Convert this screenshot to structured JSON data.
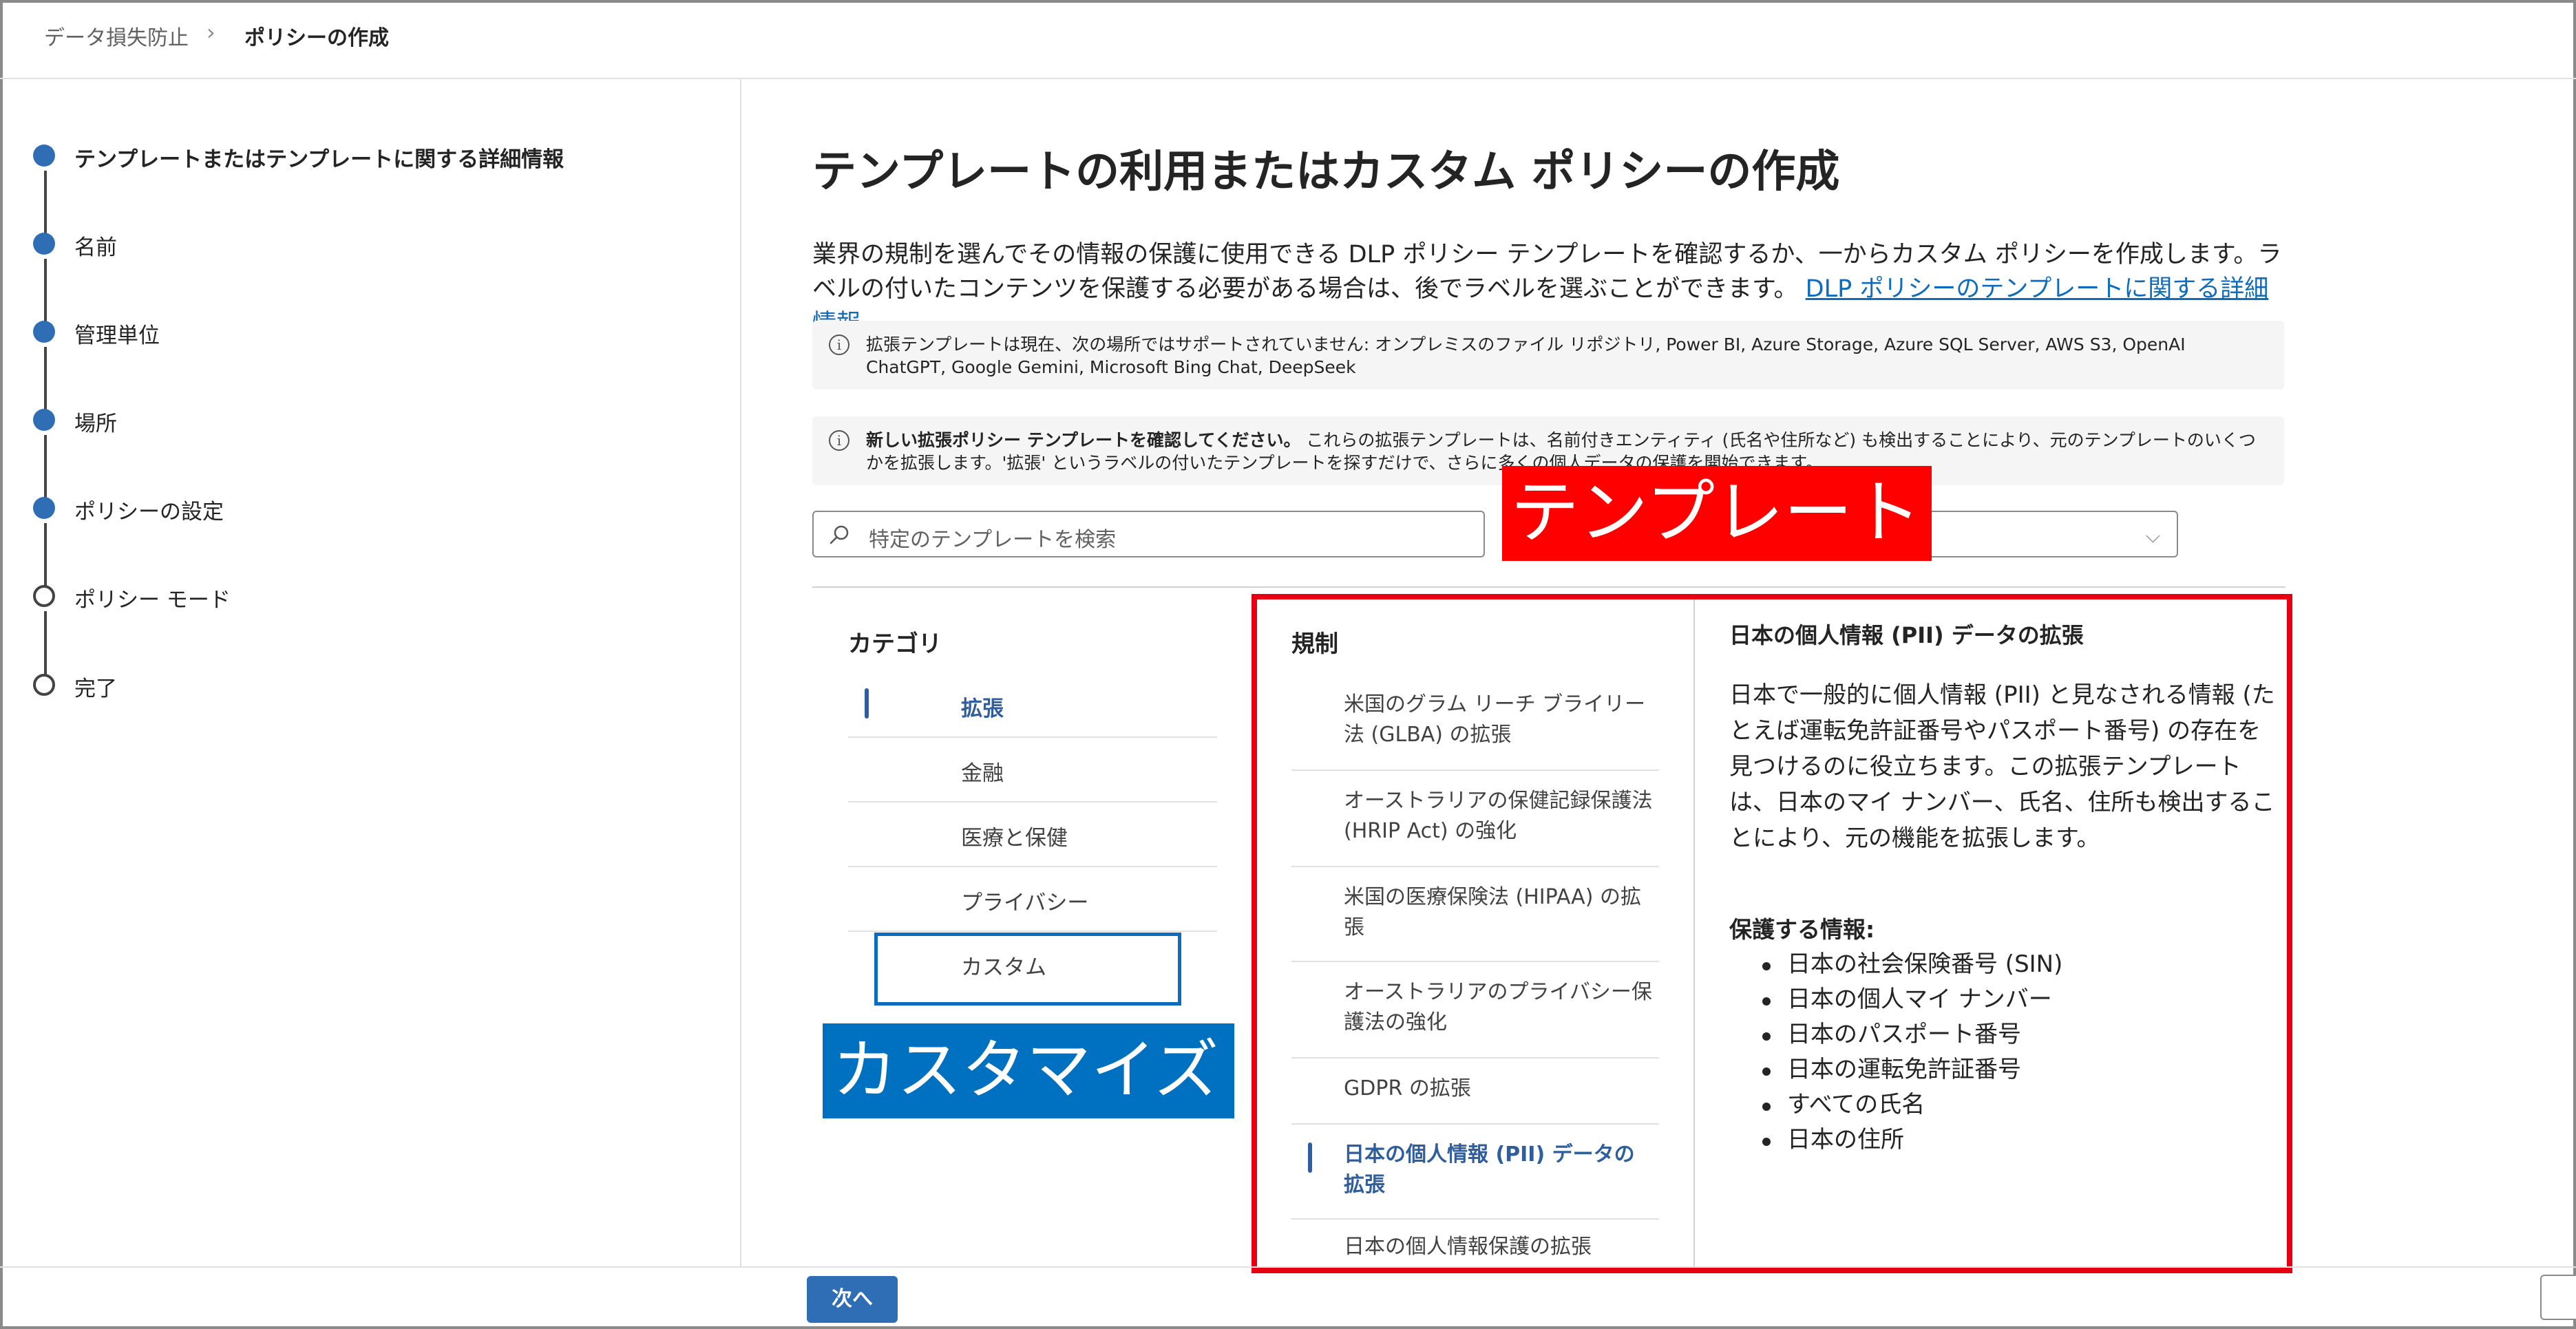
{
  "breadcrumb": {
    "parent": "データ損失防止",
    "separator": "›",
    "current": "ポリシーの作成"
  },
  "steps": [
    {
      "label": "テンプレートまたはテンプレートに関する詳細情報",
      "state": "current"
    },
    {
      "label": "名前",
      "state": "completed"
    },
    {
      "label": "管理単位",
      "state": "completed"
    },
    {
      "label": "場所",
      "state": "completed"
    },
    {
      "label": "ポリシーの設定",
      "state": "completed"
    },
    {
      "label": "ポリシー モード",
      "state": "pending"
    },
    {
      "label": "完了",
      "state": "pending"
    }
  ],
  "main": {
    "title": "テンプレートの利用またはカスタム ポリシーの作成",
    "description": "業界の規制を選んでその情報の保護に使用できる DLP ポリシー テンプレートを確認するか、一からカスタム ポリシーを作成します。ラベルの付いたコンテンツを保護する必要がある場合は、後でラベルを選ぶことができます。",
    "learn_more_link": "DLP ポリシーのテンプレートに関する詳細情報",
    "info1": "拡張テンプレートは現在、次の場所ではサポートされていません: オンプレミスのファイル リポジトリ, Power BI, Azure Storage, Azure SQL Server, AWS S3, OpenAI ChatGPT, Google Gemini, Microsoft Bing Chat, DeepSeek",
    "info2_bold": "新しい拡張ポリシー テンプレートを確認してください。",
    "info2_text": " これらの拡張テンプレートは、名前付きエンティティ (氏名や住所など) も検出することにより、元のテンプレートのいくつかを拡張します。'拡張' というラベルの付いたテンプレートを探すだけで、さらに多くの個人データの保護を開始できます。",
    "search_placeholder": "特定のテンプレートを検索",
    "dropdown_value": ""
  },
  "categories": {
    "heading": "カテゴリ",
    "items": [
      "拡張",
      "金融",
      "医療と保健",
      "プライバシー",
      "カスタム"
    ],
    "selected": "拡張"
  },
  "regulations": {
    "heading": "規制",
    "items": [
      "米国のグラム リーチ ブライリー法 (GLBA) の拡張",
      "オーストラリアの保健記録保護法 (HRIP Act) の強化",
      "米国の医療保険法 (HIPAA) の拡張",
      "オーストラリアのプライバシー保護法の強化",
      "GDPR の拡張",
      "日本の個人情報 (PII) データの拡張",
      "日本の個人情報保護の拡張"
    ],
    "selected": "日本の個人情報 (PII) データの拡張"
  },
  "detail": {
    "title": "日本の個人情報 (PII) データの拡張",
    "body": "日本で一般的に個人情報 (PII) と見なされる情報 (たとえば運転免許証番号やパスポート番号) の存在を見つけるのに役立ちます。この拡張テンプレートは、日本のマイ ナンバー、氏名、住所も検出することにより、元の機能を拡張します。",
    "protect_heading": "保護する情報:",
    "protect_items": [
      "日本の社会保険番号 (SIN)",
      "日本の個人マイ ナンバー",
      "日本のパスポート番号",
      "日本の運転免許証番号",
      "すべての氏名",
      "日本の住所"
    ]
  },
  "annotations": {
    "red_label": "テンプレート",
    "blue_label": "カスタマイズ",
    "red_color": "#ff0000",
    "blue_color": "#0070c0"
  },
  "footer": {
    "next_button": "次へ",
    "corner_button": "‹"
  },
  "colors": {
    "accent": "#2f6db5",
    "link": "#0f6cbd"
  }
}
